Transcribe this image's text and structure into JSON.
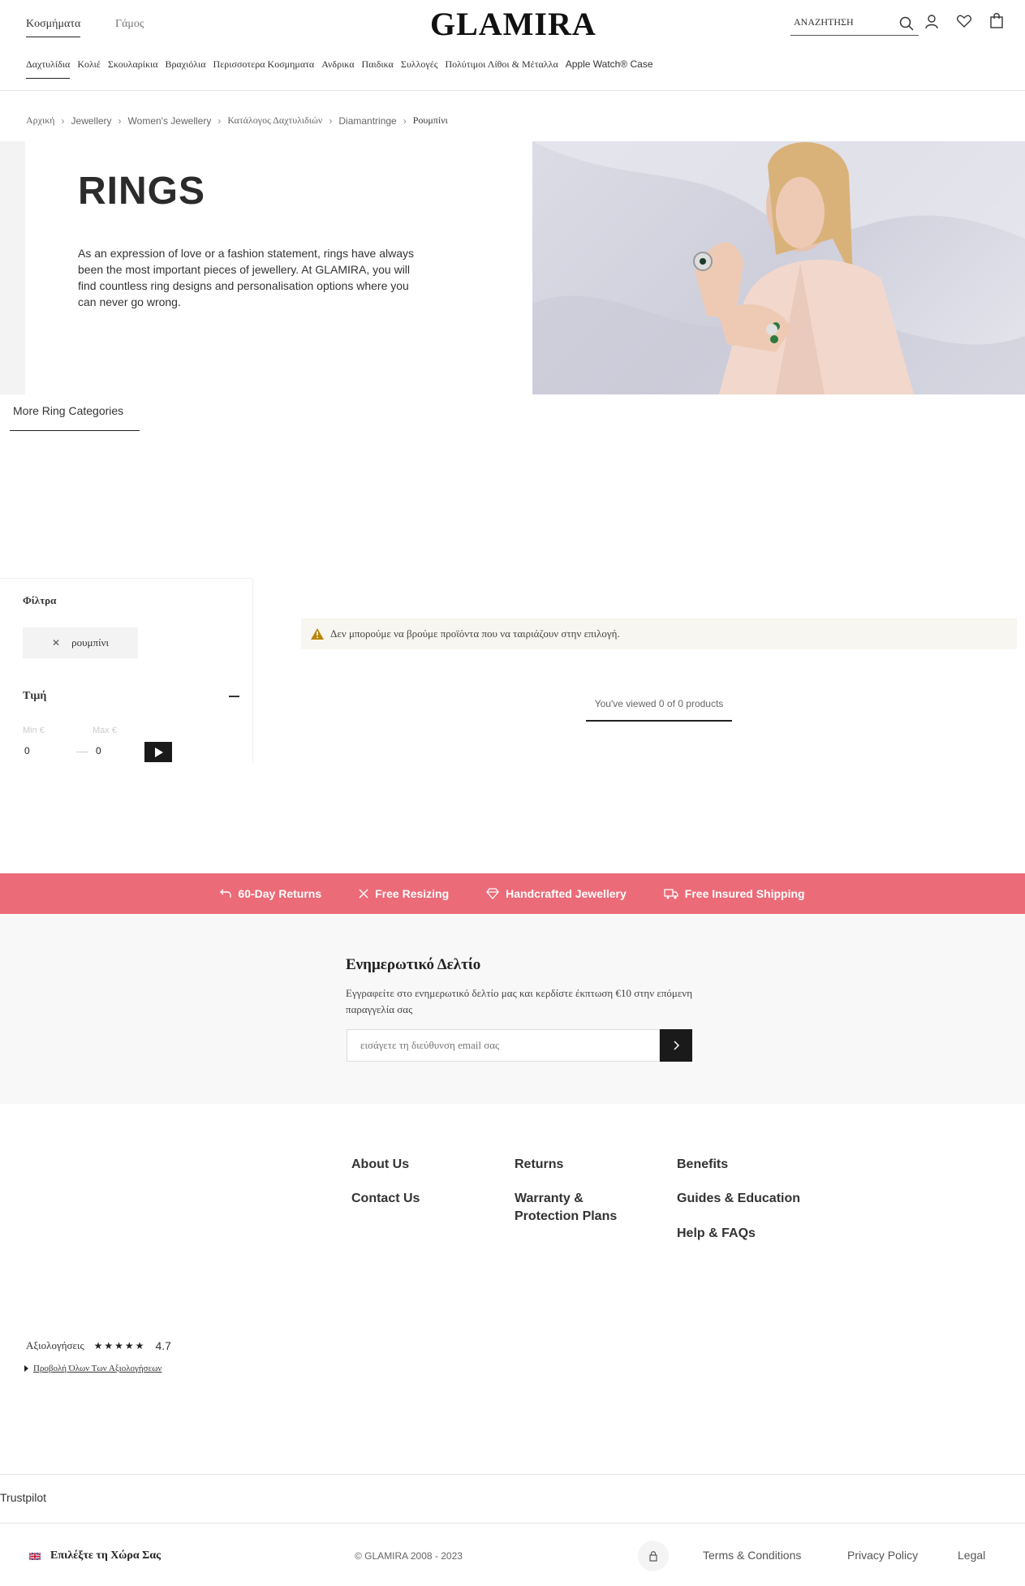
{
  "header": {
    "top_links": [
      "Κοσμήματα",
      "Γάμος"
    ],
    "logo": "GLAMIRA",
    "search_label": "ΑΝΑΖΗΤΗΣΗ",
    "nav": [
      "Δαχτυλίδια",
      "Κολιέ",
      "Σκουλαρίκια",
      "Βραχιόλια",
      "Περισσοτερα Κοσμηματα",
      "Ανδρικα",
      "Παιδικα",
      "Συλλογές",
      "Πολύτιμοι Λίθοι & Μέταλλα",
      "Apple Watch® Case"
    ]
  },
  "breadcrumb": [
    "Αρχική",
    "Jewellery",
    "Women's Jewellery",
    "Κατάλογος Δαχτυλιδιών",
    "Diamantringe",
    "Ρουμπίνι"
  ],
  "hero": {
    "title": "RINGS",
    "text": "As an expression of love or a fashion statement, rings have always been the most important pieces of jewellery. At GLAMIRA, you will find countless ring designs and personalisation options where you can never go wrong."
  },
  "more_categories": "More Ring Categories",
  "filters": {
    "title": "Φίλτρα",
    "active_chip": "ρουμπίνι",
    "price_title": "Τιμή",
    "min_label": "Min €",
    "max_label": "Max €",
    "min_value": "0",
    "max_value": "0"
  },
  "results": {
    "alert": "Δεν μπορούμε να βρούμε προϊόντα που να ταιριάζουν στην επιλογή.",
    "viewed": "You've viewed 0 of 0 products"
  },
  "perks": [
    "60-Day Returns",
    "Free Resizing",
    "Handcrafted Jewellery",
    "Free Insured Shipping"
  ],
  "newsletter": {
    "title": "Ενημερωτικό Δελτίο",
    "text": "Εγγραφείτε στο ενημερωτικό δελτίο μας και κερδίστε έκπτωση €10 στην επόμενη παραγγελία σας",
    "placeholder": "εισάγετε τη διεύθυνση email σας"
  },
  "footer": {
    "col1": [
      "About Us",
      "Contact Us"
    ],
    "col2": [
      "Returns",
      "Warranty & Protection Plans"
    ],
    "col3": [
      "Benefits",
      "Guides & Education",
      "Help & FAQs"
    ],
    "reviews_label": "Αξιολογήσεις",
    "stars": "★★★★★",
    "score": "4.7",
    "all_reviews": "Προβολή Όλων Των Αξιολογήσεων",
    "trustpilot": "Trustpilot",
    "country": "Επιλέξτε τη Χώρα Σας",
    "copyright": "© GLAMIRA 2008 - 2023",
    "legal_links": [
      "Terms & Conditions",
      "Privacy Policy",
      "Legal"
    ]
  },
  "colors": {
    "accent": "#ec6b78",
    "dark": "#1a1a1a",
    "alert_bg": "#f8f6f0",
    "warning": "#b8860b"
  }
}
